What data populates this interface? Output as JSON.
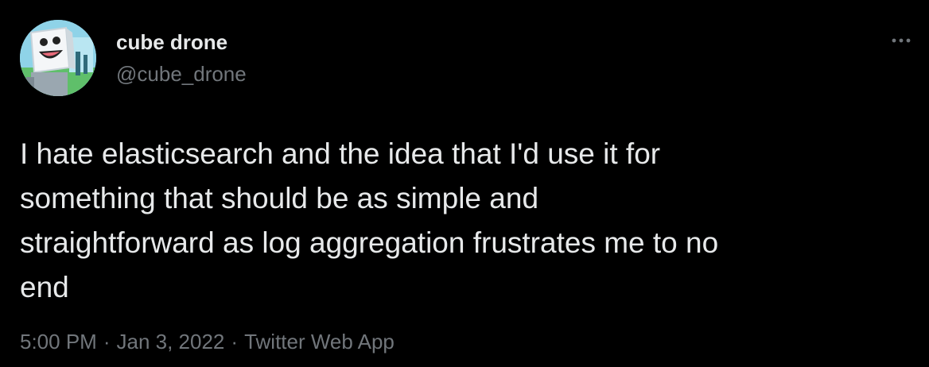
{
  "author": {
    "display_name": "cube drone",
    "handle": "@cube_drone",
    "avatar_icon": "cube-robot-avatar"
  },
  "tweet": {
    "text": "I hate elasticsearch and the idea that I'd use it for\nsomething that should be as simple and\nstraightforward as log aggregation frustrates me to no\nend"
  },
  "meta": {
    "time": "5:00 PM",
    "separator": "·",
    "date": "Jan 3, 2022",
    "source": "Twitter Web App"
  },
  "colors": {
    "background": "#000000",
    "primary_text": "#e7e9ea",
    "secondary_text": "#71767b"
  },
  "icons": {
    "more": "more-horizontal-icon"
  }
}
